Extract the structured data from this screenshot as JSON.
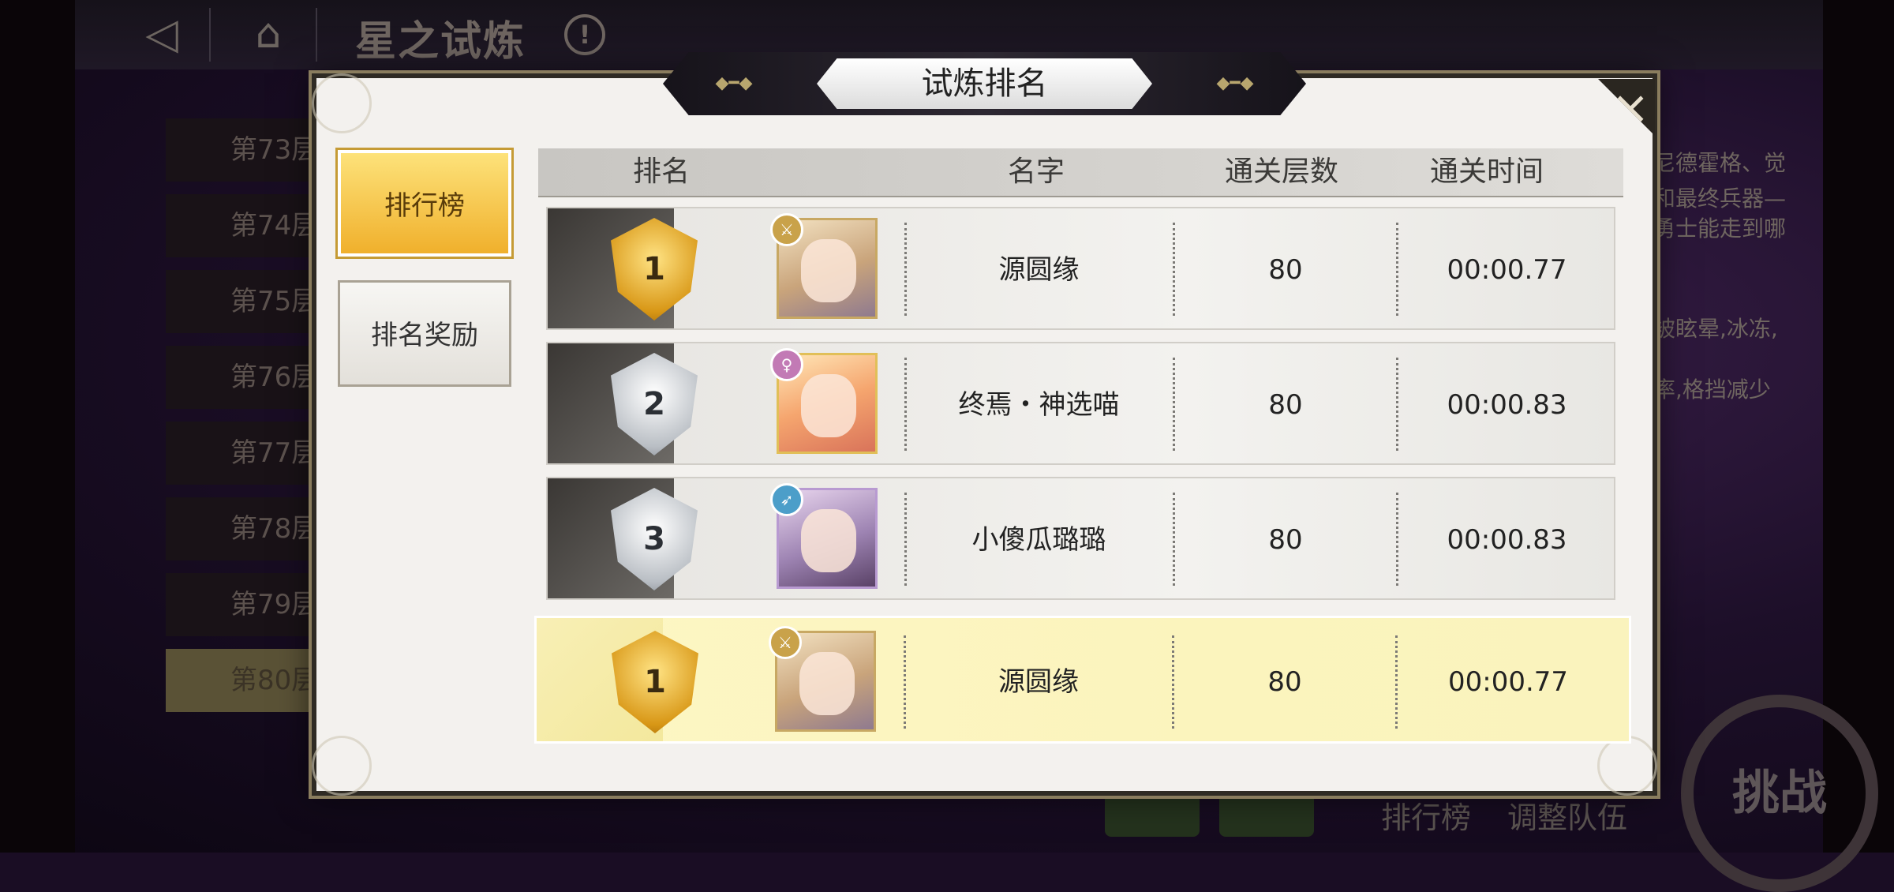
{
  "background": {
    "title": "星之试炼",
    "episodes": [
      "第73层",
      "第74层",
      "第75层",
      "第76层",
      "第77层",
      "第78层",
      "第79层",
      "第80层"
    ],
    "right_text": [
      "尼德霍格、觉",
      "和最终兵器—",
      "勇士能走到哪",
      "被眩晕,冰冻,",
      "率,格挡减少"
    ],
    "bottom_buttons": [
      "排行榜",
      "调整队伍"
    ],
    "challenge_label": "挑战"
  },
  "modal": {
    "title": "试炼排名",
    "close_label": "×",
    "tabs": [
      {
        "label": "排行榜",
        "active": true
      },
      {
        "label": "排名奖励",
        "active": false
      }
    ],
    "columns": [
      "排名",
      "名字",
      "通关层数",
      "通关时间"
    ],
    "rows": [
      {
        "rank": "1",
        "medal": "gold",
        "name": "源圆缘",
        "floors": "80",
        "time": "00:00.77"
      },
      {
        "rank": "2",
        "medal": "silver",
        "name": "终焉・神选喵",
        "floors": "80",
        "time": "00:00.83"
      },
      {
        "rank": "3",
        "medal": "silver",
        "name": "小傻瓜璐璐",
        "floors": "80",
        "time": "00:00.83"
      }
    ],
    "my_row": {
      "rank": "1",
      "medal": "gold",
      "name": "源圆缘",
      "floors": "80",
      "time": "00:00.77"
    }
  },
  "colors": {
    "active_tab": "#f0b02c",
    "my_row_bg": "#fbf4bd",
    "gold": "#d89716",
    "silver": "#b9bec4"
  }
}
